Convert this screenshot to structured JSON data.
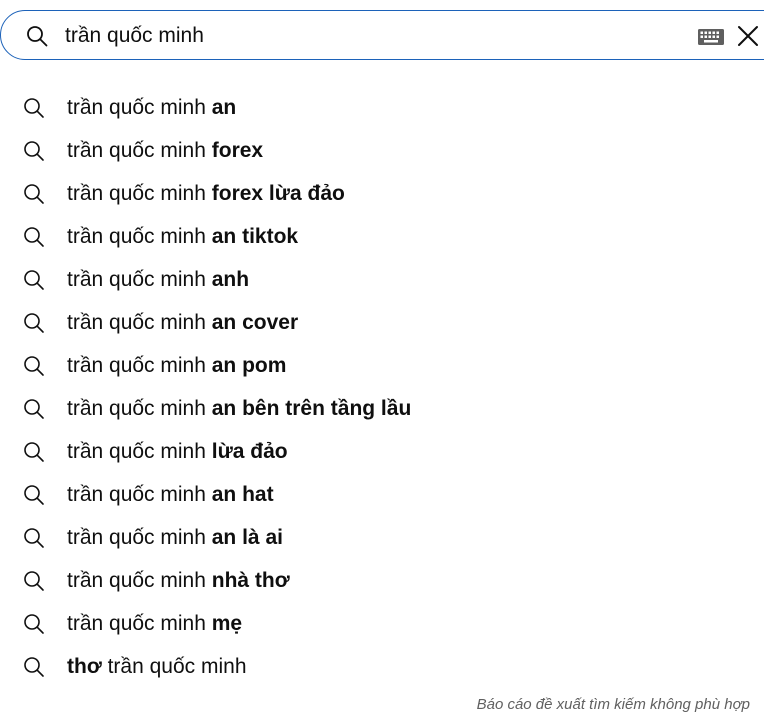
{
  "search": {
    "query": "trần quốc minh",
    "keyboard_icon": "keyboard-icon",
    "clear_icon": "close-icon"
  },
  "suggestions": [
    {
      "prefix": "trần quốc minh ",
      "suffix": "an"
    },
    {
      "prefix": "trần quốc minh ",
      "suffix": "forex"
    },
    {
      "prefix": "trần quốc minh ",
      "suffix": "forex lừa đảo"
    },
    {
      "prefix": "trần quốc minh ",
      "suffix": "an tiktok"
    },
    {
      "prefix": "trần quốc minh ",
      "suffix": "anh"
    },
    {
      "prefix": "trần quốc minh ",
      "suffix": "an cover"
    },
    {
      "prefix": "trần quốc minh ",
      "suffix": "an pom"
    },
    {
      "prefix": "trần quốc minh ",
      "suffix": "an bên trên tầng lầu"
    },
    {
      "prefix": "trần quốc minh ",
      "suffix": "lừa đảo"
    },
    {
      "prefix": "trần quốc minh ",
      "suffix": "an hat"
    },
    {
      "prefix": "trần quốc minh ",
      "suffix": "an là ai"
    },
    {
      "prefix": "trần quốc minh ",
      "suffix": "nhà thơ"
    },
    {
      "prefix": "trần quốc minh ",
      "suffix": "mẹ"
    },
    {
      "lead": "thơ",
      "prefix": " trần quốc minh",
      "suffix": ""
    }
  ],
  "report_link": "Báo cáo đề xuất tìm kiếm không phù hợp"
}
